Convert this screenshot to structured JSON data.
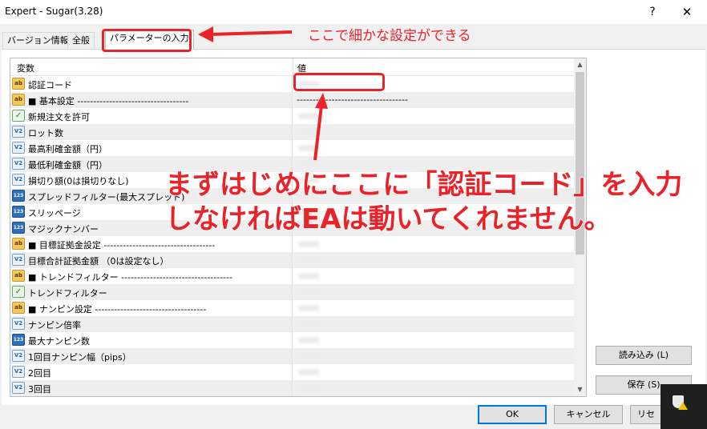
{
  "window": {
    "title": "Expert - Sugar(3.28)",
    "help": "?",
    "close": "✕"
  },
  "tabs": [
    {
      "label": "バージョン情報"
    },
    {
      "label": "全般"
    },
    {
      "label": "パラメーターの入力"
    }
  ],
  "table": {
    "header_variable": "変数",
    "header_value": "値",
    "rows": [
      {
        "icon": "ab",
        "label": "認証コード",
        "value": ""
      },
      {
        "icon": "ab",
        "label": "■ 基本設定 -----------------------------------",
        "value": "-----------------------------------"
      },
      {
        "icon": "bool",
        "label": "新規注文を許可",
        "value": ""
      },
      {
        "icon": "v2",
        "label": "ロット数",
        "value": ""
      },
      {
        "icon": "v2",
        "label": "最高利確金額（円）",
        "value": ""
      },
      {
        "icon": "v2",
        "label": "最低利確金額（円）",
        "value": ""
      },
      {
        "icon": "v2",
        "label": "損切り額(0は損切りなし)",
        "value": ""
      },
      {
        "icon": "123",
        "label": "スプレッドフィルター(最大スプレッド)",
        "value": ""
      },
      {
        "icon": "123",
        "label": "スリッページ",
        "value": ""
      },
      {
        "icon": "123",
        "label": "マジックナンバー",
        "value": ""
      },
      {
        "icon": "ab",
        "label": "■ 目標証拠金設定 -----------------------------------",
        "value": ""
      },
      {
        "icon": "v2",
        "label": "目標合計証拠金額 （0は設定なし）",
        "value": ""
      },
      {
        "icon": "ab",
        "label": "■ トレンドフィルター -----------------------------------",
        "value": ""
      },
      {
        "icon": "bool",
        "label": "トレンドフィルター",
        "value": ""
      },
      {
        "icon": "ab",
        "label": "■ ナンピン設定 -----------------------------------",
        "value": ""
      },
      {
        "icon": "v2",
        "label": "ナンピン倍率",
        "value": ""
      },
      {
        "icon": "123",
        "label": "最大ナンピン数",
        "value": ""
      },
      {
        "icon": "v2",
        "label": "1回目ナンピン幅（pips）",
        "value": ""
      },
      {
        "icon": "v2",
        "label": "2回目",
        "value": ""
      },
      {
        "icon": "v2",
        "label": "3回目",
        "value": ""
      }
    ]
  },
  "icon_text": {
    "ab": "ab",
    "v2": "V2",
    "123": "123",
    "bool": "✓"
  },
  "buttons": {
    "load": "読み込み (L)",
    "save": "保存 (S)",
    "ok": "OK",
    "cancel": "キャンセル",
    "reset": "リセ"
  },
  "annotations": {
    "tab_note": "ここで細かな設定ができる",
    "main_line1": "まずはじめにここに「認証コード」を入力",
    "main_line2": "しなければEAは動いてくれません。"
  },
  "colors": {
    "annotation": "#e8232a",
    "primary_border": "#0078d7"
  }
}
